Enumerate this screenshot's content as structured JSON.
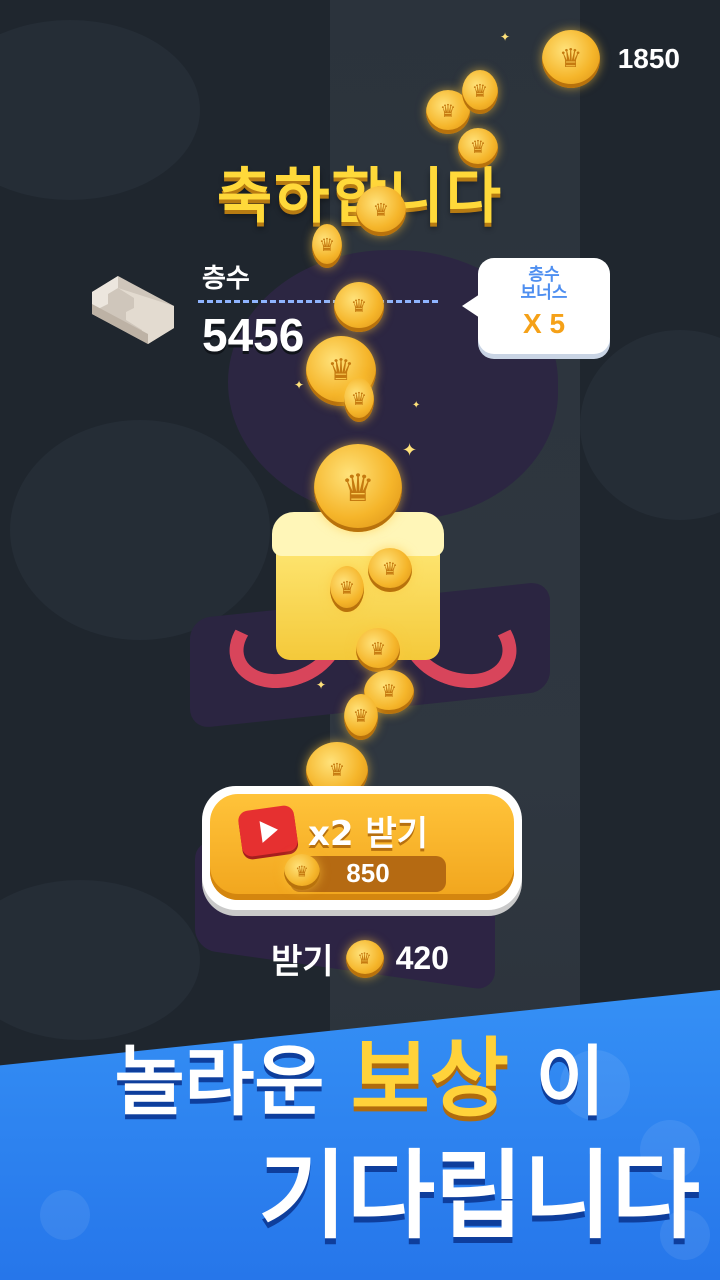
{
  "header": {
    "coins": "1850",
    "coin_icon": "crown-coin-icon"
  },
  "result": {
    "title": "축하합니다",
    "floor_label": "층수",
    "floor_value": "5456",
    "bonus_label_line1": "층수",
    "bonus_label_line2": "보너스",
    "bonus_value": "X 5"
  },
  "double_reward": {
    "label": "x2 받기",
    "amount": "850",
    "icon": "video-play-icon"
  },
  "claim": {
    "label": "받기",
    "amount": "420"
  },
  "banner": {
    "line1_prefix": "놀라운",
    "line1_highlight": "보상",
    "line1_suffix": "이",
    "line2": "기다립니다"
  },
  "colors": {
    "background": "#1f262e",
    "title": "#ffd93a",
    "button": "#f1a51d",
    "banner": "#2676ea",
    "bonus_text": "#4f8ff0",
    "bonus_value": "#f5a118"
  }
}
